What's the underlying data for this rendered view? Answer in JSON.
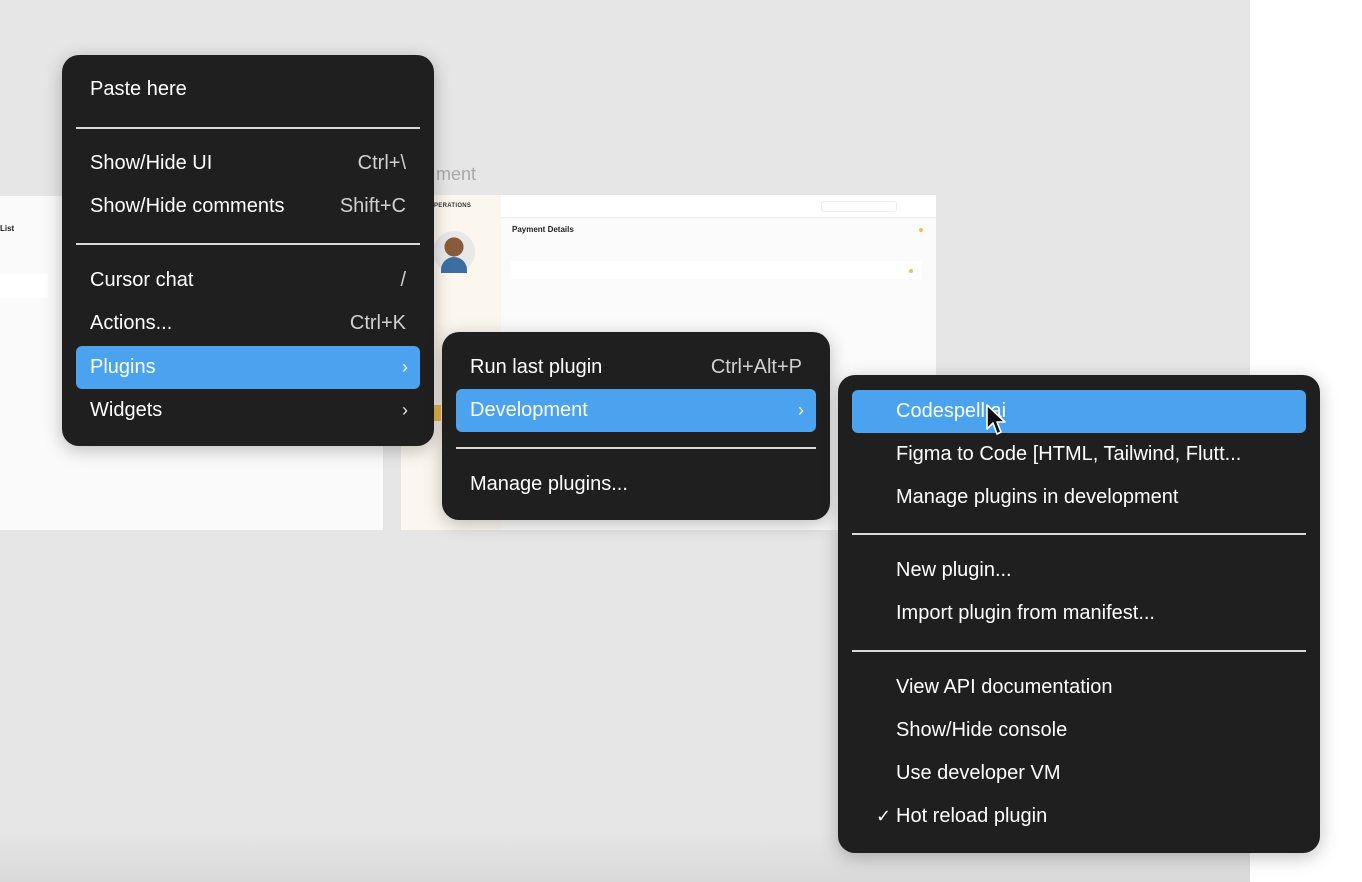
{
  "canvas": {
    "left_frame": {
      "title": "List",
      "small_text": "",
      "card_text": ""
    },
    "right_frame": {
      "label": "ment",
      "sidebar_title": "OPERATIONS",
      "sidebar_name": "",
      "payment_title": "Payment Details"
    }
  },
  "context_menu": {
    "paste": {
      "label": "Paste here"
    },
    "show_hide_ui": {
      "label": "Show/Hide UI",
      "shortcut": "Ctrl+\\"
    },
    "show_hide_comments": {
      "label": "Show/Hide comments",
      "shortcut": "Shift+C"
    },
    "cursor_chat": {
      "label": "Cursor chat",
      "shortcut": "/"
    },
    "actions": {
      "label": "Actions...",
      "shortcut": "Ctrl+K"
    },
    "plugins": {
      "label": "Plugins",
      "arrow": "›"
    },
    "widgets": {
      "label": "Widgets",
      "arrow": "›"
    }
  },
  "plugins_menu": {
    "run_last": {
      "label": "Run last plugin",
      "shortcut": "Ctrl+Alt+P"
    },
    "development": {
      "label": "Development",
      "arrow": "›"
    },
    "manage": {
      "label": "Manage plugins..."
    }
  },
  "development_menu": {
    "codespell": {
      "label": "Codespell.ai"
    },
    "figma_to_code": {
      "label": "Figma to Code [HTML, Tailwind, Flutt..."
    },
    "manage_dev": {
      "label": "Manage plugins in development"
    },
    "new_plugin": {
      "label": "New plugin..."
    },
    "import_manifest": {
      "label": "Import plugin from manifest..."
    },
    "api_docs": {
      "label": "View API documentation"
    },
    "console": {
      "label": "Show/Hide console"
    },
    "dev_vm": {
      "label": "Use developer VM"
    },
    "hot_reload": {
      "label": "Hot reload plugin",
      "check": "✓"
    }
  },
  "colors": {
    "menu_bg": "#1f1f1f",
    "highlight": "#4ba3f0",
    "canvas_bg": "#e6e6e6"
  },
  "icons": {
    "cursor": "pointer-cursor-icon",
    "submenu": "chevron-right-icon",
    "check": "checkmark-icon"
  }
}
